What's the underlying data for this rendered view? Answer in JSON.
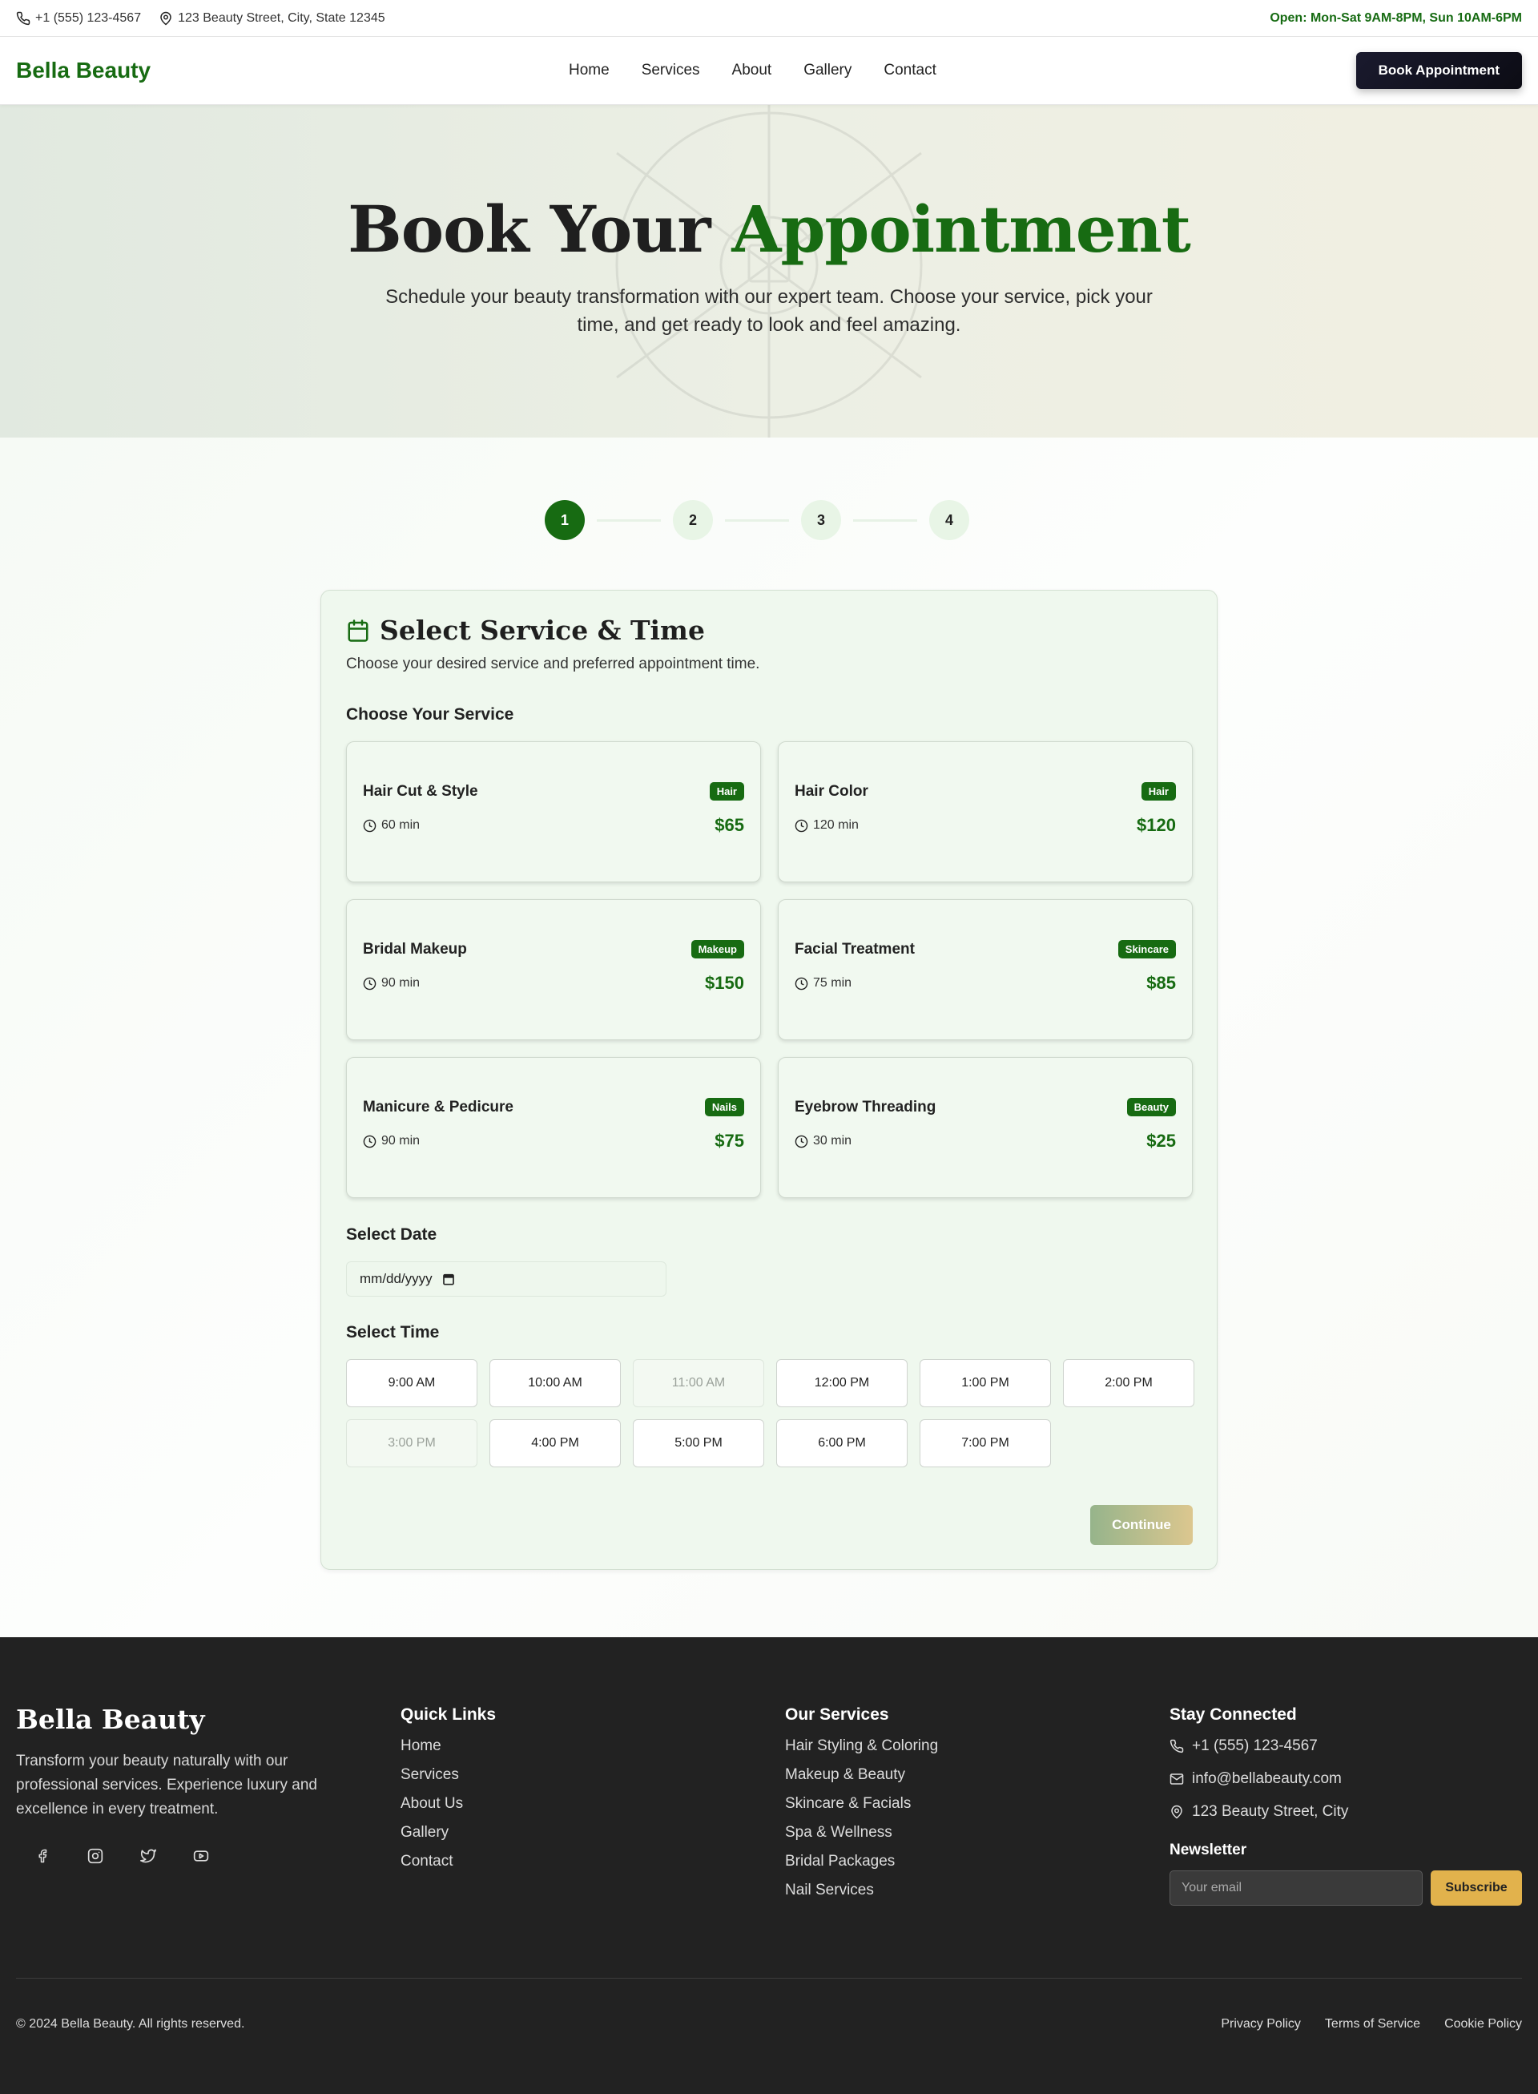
{
  "topbar": {
    "phone": "+1 (555) 123-4567",
    "address": "123 Beauty Street, City, State 12345",
    "hours": "Open: Mon-Sat 9AM-8PM, Sun 10AM-6PM"
  },
  "nav": {
    "brand": "Bella Beauty",
    "links": [
      "Home",
      "Services",
      "About",
      "Gallery",
      "Contact"
    ],
    "cta": "Book Appointment"
  },
  "hero": {
    "title_part1": "Book Your",
    "title_part2": "Appointment",
    "subtitle": "Schedule your beauty transformation with our expert team. Choose your service, pick your time, and get ready to look and feel amazing."
  },
  "steps": [
    "1",
    "2",
    "3",
    "4"
  ],
  "booking": {
    "title": "Select Service & Time",
    "subtitle": "Choose your desired service and preferred appointment time.",
    "service_label": "Choose Your Service",
    "services": [
      {
        "name": "Hair Cut & Style",
        "category": "Hair",
        "duration": "60 min",
        "price": "$65"
      },
      {
        "name": "Hair Color",
        "category": "Hair",
        "duration": "120 min",
        "price": "$120"
      },
      {
        "name": "Bridal Makeup",
        "category": "Makeup",
        "duration": "90 min",
        "price": "$150"
      },
      {
        "name": "Facial Treatment",
        "category": "Skincare",
        "duration": "75 min",
        "price": "$85"
      },
      {
        "name": "Manicure & Pedicure",
        "category": "Nails",
        "duration": "90 min",
        "price": "$75"
      },
      {
        "name": "Eyebrow Threading",
        "category": "Beauty",
        "duration": "30 min",
        "price": "$25"
      }
    ],
    "date_label": "Select Date",
    "date_placeholder": "mm/dd/yyyy",
    "time_label": "Select Time",
    "times": [
      {
        "label": "9:00 AM",
        "available": true
      },
      {
        "label": "10:00 AM",
        "available": true
      },
      {
        "label": "11:00 AM",
        "available": false
      },
      {
        "label": "12:00 PM",
        "available": true
      },
      {
        "label": "1:00 PM",
        "available": true
      },
      {
        "label": "2:00 PM",
        "available": true
      },
      {
        "label": "3:00 PM",
        "available": false
      },
      {
        "label": "4:00 PM",
        "available": true
      },
      {
        "label": "5:00 PM",
        "available": true
      },
      {
        "label": "6:00 PM",
        "available": true
      },
      {
        "label": "7:00 PM",
        "available": true
      }
    ],
    "continue_label": "Continue"
  },
  "footer": {
    "brand": "Bella Beauty",
    "description": "Transform your beauty naturally with our professional services. Experience luxury and excellence in every treatment.",
    "socials": [
      "facebook-icon",
      "instagram-icon",
      "twitter-icon",
      "youtube-icon"
    ],
    "quick_links_title": "Quick Links",
    "quick_links": [
      "Home",
      "Services",
      "About Us",
      "Gallery",
      "Contact"
    ],
    "services_title": "Our Services",
    "services": [
      "Hair Styling & Coloring",
      "Makeup & Beauty",
      "Skincare & Facials",
      "Spa & Wellness",
      "Bridal Packages",
      "Nail Services"
    ],
    "connect_title": "Stay Connected",
    "phone": "+1 (555) 123-4567",
    "email": "info@bellabeauty.com",
    "address": "123 Beauty Street, City",
    "newsletter_title": "Newsletter",
    "newsletter_placeholder": "Your email",
    "subscribe_label": "Subscribe",
    "copyright": "© 2024 Bella Beauty. All rights reserved.",
    "legal_links": [
      "Privacy Policy",
      "Terms of Service",
      "Cookie Policy"
    ]
  },
  "colors": {
    "brand_green": "#176b12",
    "gold": "#e2b24c",
    "dark": "#222222"
  }
}
